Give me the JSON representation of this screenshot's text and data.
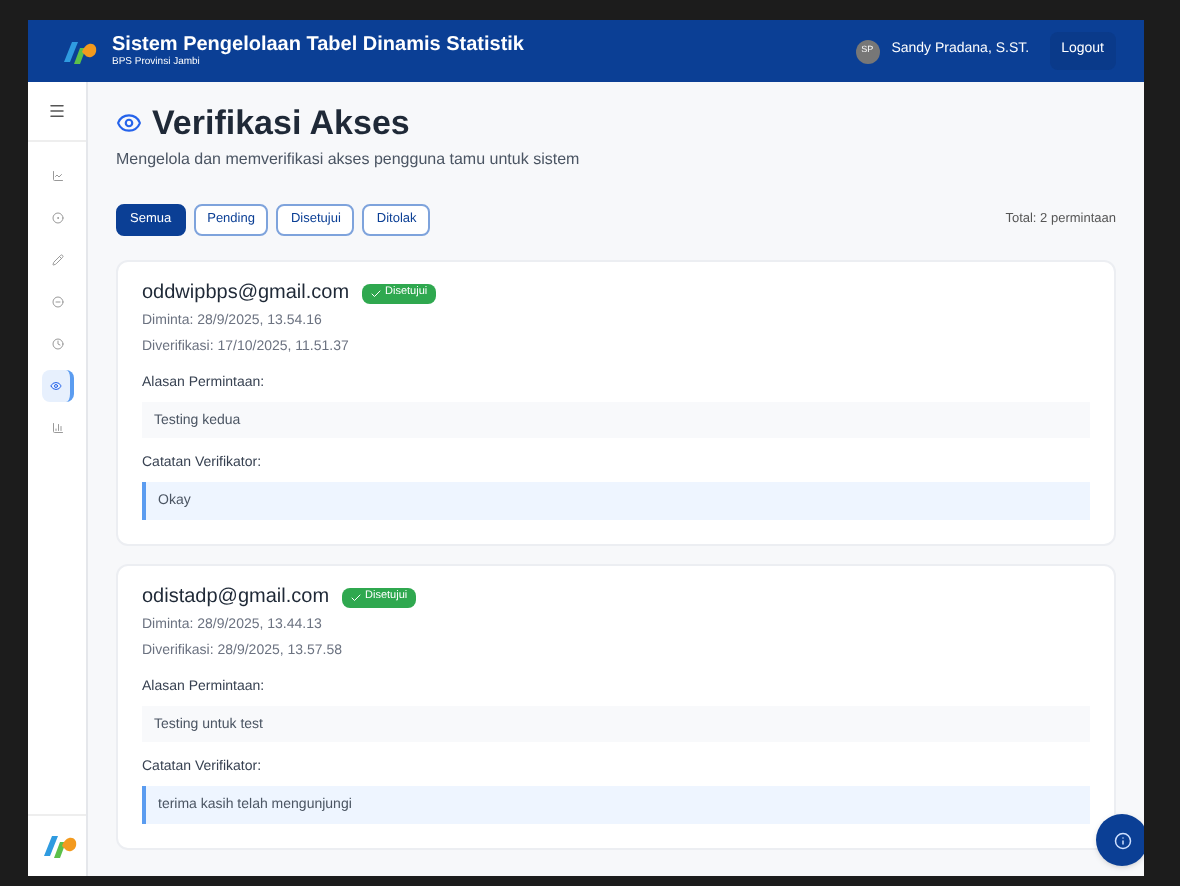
{
  "header": {
    "title": "Sistem Pengelolaan Tabel Dinamis Statistik",
    "subtitle": "BPS Provinsi Jambi",
    "user": {
      "initials": "SP",
      "name": "Sandy Pradana, S.ST."
    },
    "logout": "Logout"
  },
  "sidebar": {
    "items": [
      {
        "selected": false
      },
      {
        "selected": false
      },
      {
        "selected": false
      },
      {
        "selected": false
      },
      {
        "selected": false
      },
      {
        "selected": true
      },
      {
        "selected": false
      }
    ]
  },
  "page": {
    "title": "Verifikasi Akses",
    "description": "Mengelola dan memverifikasi akses pengguna tamu untuk sistem"
  },
  "filters": [
    {
      "label": "Semua",
      "selected": true
    },
    {
      "label": "Pending",
      "selected": false
    },
    {
      "label": "Disetujui",
      "selected": false
    },
    {
      "label": "Ditolak",
      "selected": false
    }
  ],
  "total": "Total: 2 permintaan",
  "requests": [
    {
      "email": "oddwipbps@gmail.com",
      "status": {
        "kind": "approved",
        "label": "Disetujui"
      },
      "requested": "Diminta: 28/9/2025, 13.54.16",
      "verified": "Diverifikasi: 17/10/2025, 11.51.37",
      "reason_label": "Alasan Permintaan:",
      "reason": "Testing kedua",
      "note_label": "Catatan Verifikator:",
      "note": "Okay"
    },
    {
      "email": "odistadp@gmail.com",
      "status": {
        "kind": "approved",
        "label": "Disetujui"
      },
      "requested": "Diminta: 28/9/2025, 13.44.13",
      "verified": "Diverifikasi: 28/9/2025, 13.57.58",
      "reason_label": "Alasan Permintaan:",
      "reason": "Testing untuk test",
      "note_label": "Catatan Verifikator:",
      "note": "terima kasih telah mengunjungi"
    }
  ]
}
